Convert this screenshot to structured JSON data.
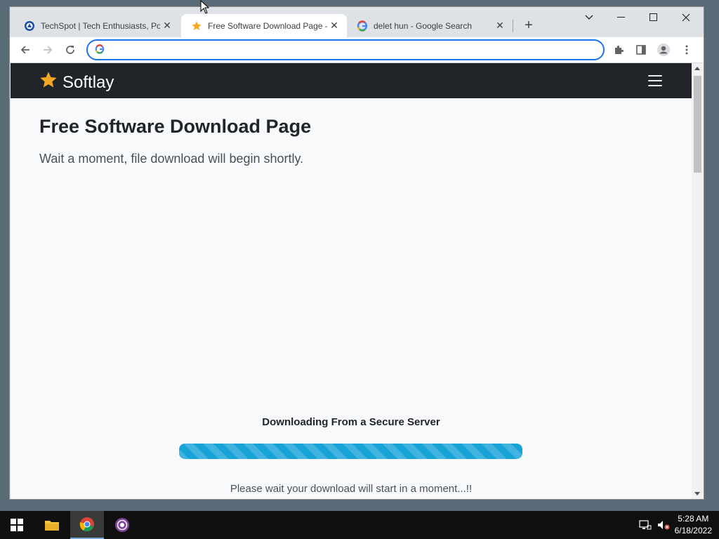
{
  "browser": {
    "tabs": [
      {
        "title": "TechSpot | Tech Enthusiasts, Pow",
        "icon": "techspot-icon",
        "active": false
      },
      {
        "title": "Free Software Download Page - ",
        "icon": "star-icon",
        "active": true
      },
      {
        "title": "delet hun - Google Search",
        "icon": "google-icon",
        "active": false
      }
    ],
    "omnibox": {
      "value": "",
      "placeholder": ""
    }
  },
  "page": {
    "brand": "Softlay",
    "heading": "Free Software Download Page",
    "lead": "Wait a moment, file download will begin shortly.",
    "download_title": "Downloading From a Secure Server",
    "progress_percent": 100,
    "download_note": "Please wait your download will start in a moment...!!"
  },
  "taskbar": {
    "time": "5:28 AM",
    "date": "6/18/2022"
  },
  "colors": {
    "navbar": "#212529",
    "progress": "#17a2d8",
    "accent": "#1a73e8",
    "brand_star": "#f5a623"
  }
}
